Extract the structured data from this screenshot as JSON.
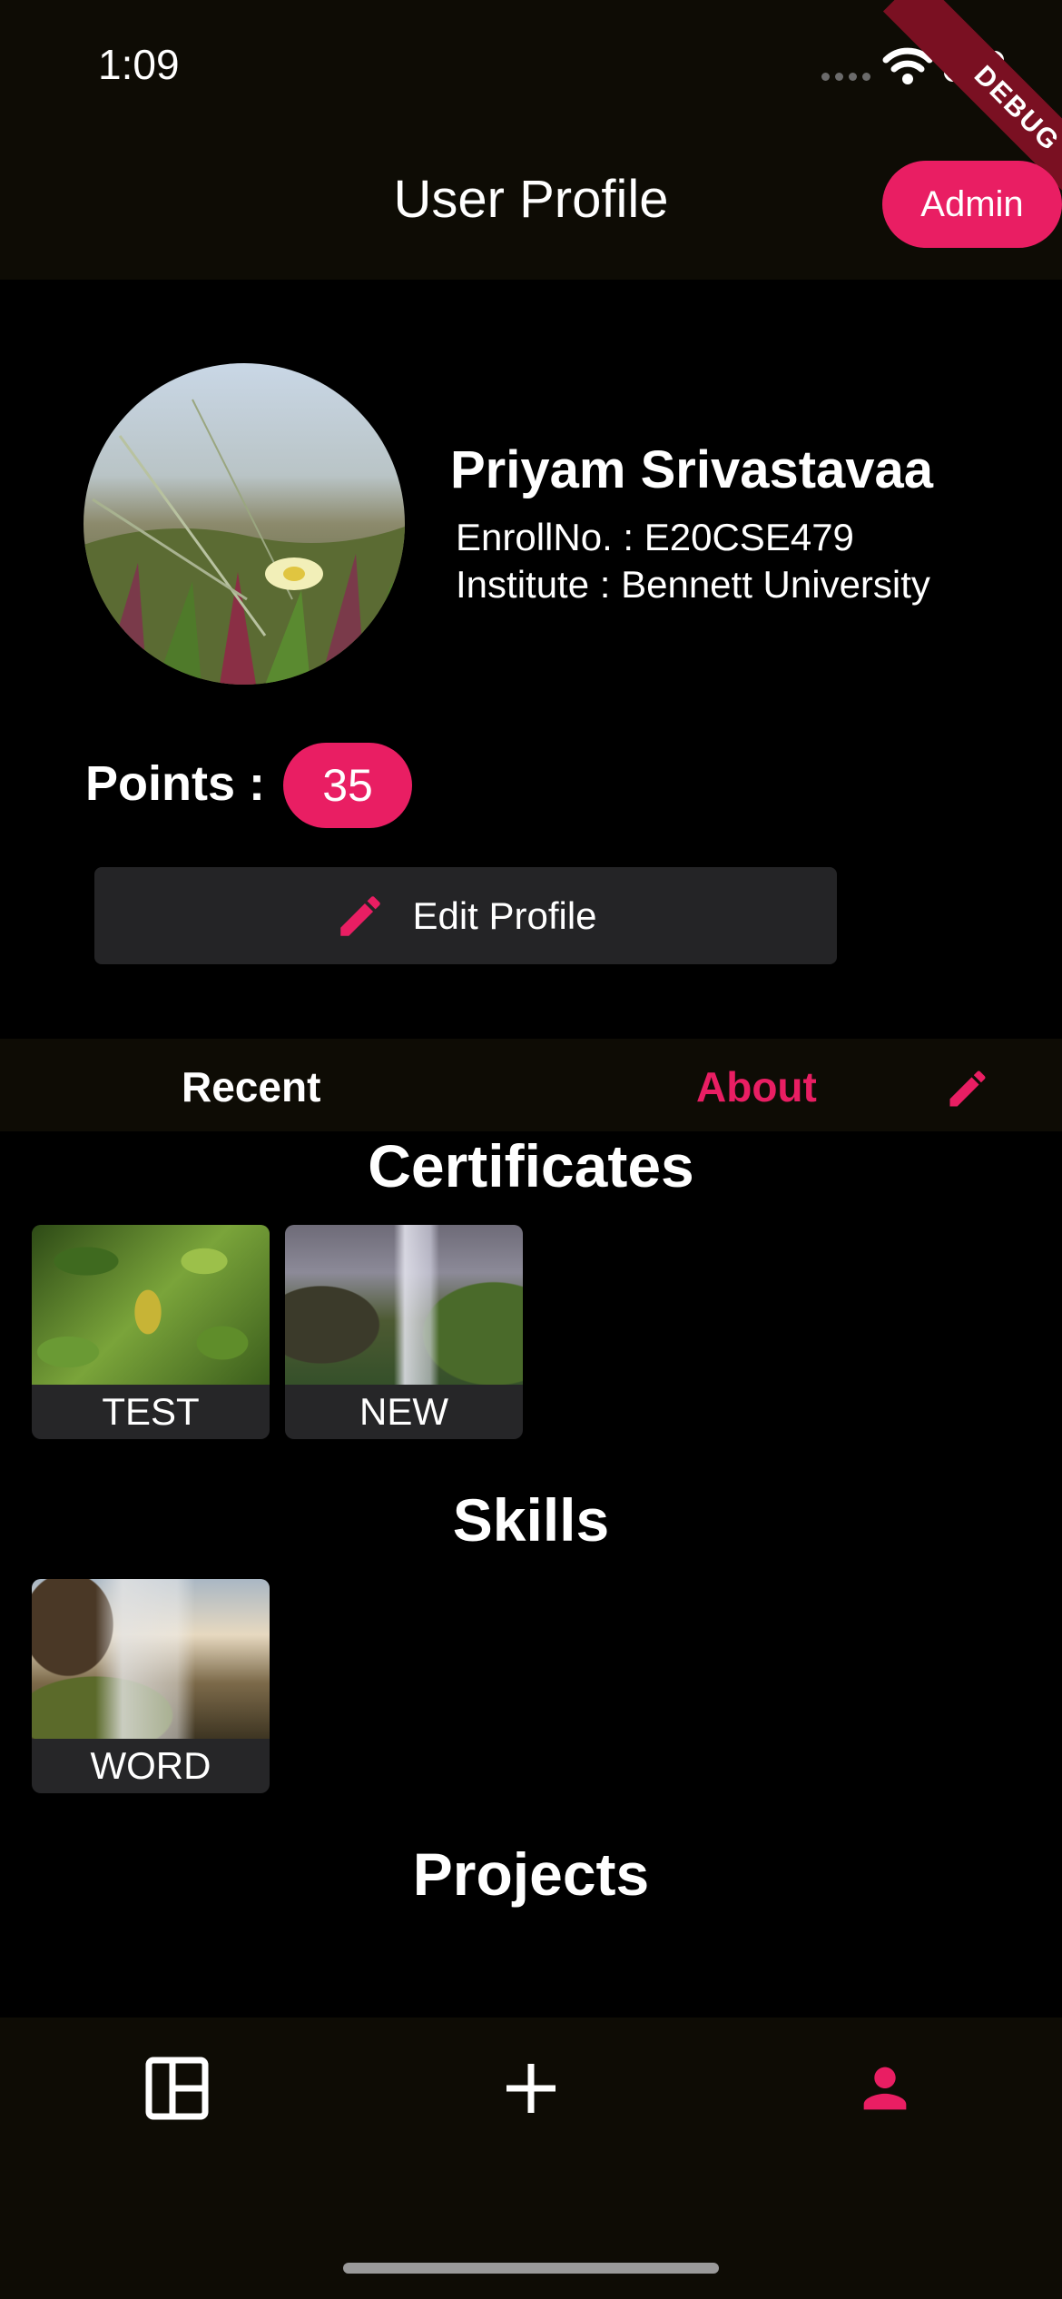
{
  "status_bar": {
    "time": "1:09"
  },
  "debug_banner": "DEBUG",
  "app_bar": {
    "title": "User Profile",
    "admin_label": "Admin"
  },
  "profile": {
    "name": "Priyam Srivastavaa",
    "enroll": "EnrollNo. : E20CSE479",
    "institute": "Institute : Bennett University",
    "points_label": "Points :",
    "points": "35",
    "edit_label": "Edit Profile"
  },
  "tabs": {
    "recent": "Recent",
    "about": "About",
    "active": "About"
  },
  "sections": {
    "certificates": {
      "title": "Certificates",
      "items": [
        {
          "label": "TEST"
        },
        {
          "label": "NEW"
        }
      ]
    },
    "skills": {
      "title": "Skills",
      "items": [
        {
          "label": "WORD"
        }
      ]
    },
    "projects": {
      "title": "Projects",
      "items": []
    }
  },
  "bottom_nav": {
    "items": [
      {
        "icon": "dashboard-icon"
      },
      {
        "icon": "add-icon"
      },
      {
        "icon": "person-icon",
        "active": true
      }
    ]
  },
  "colors": {
    "accent": "#e91e63",
    "bar_bg": "#0e0c05",
    "card_bg": "#262628",
    "button_bg": "#242426"
  }
}
